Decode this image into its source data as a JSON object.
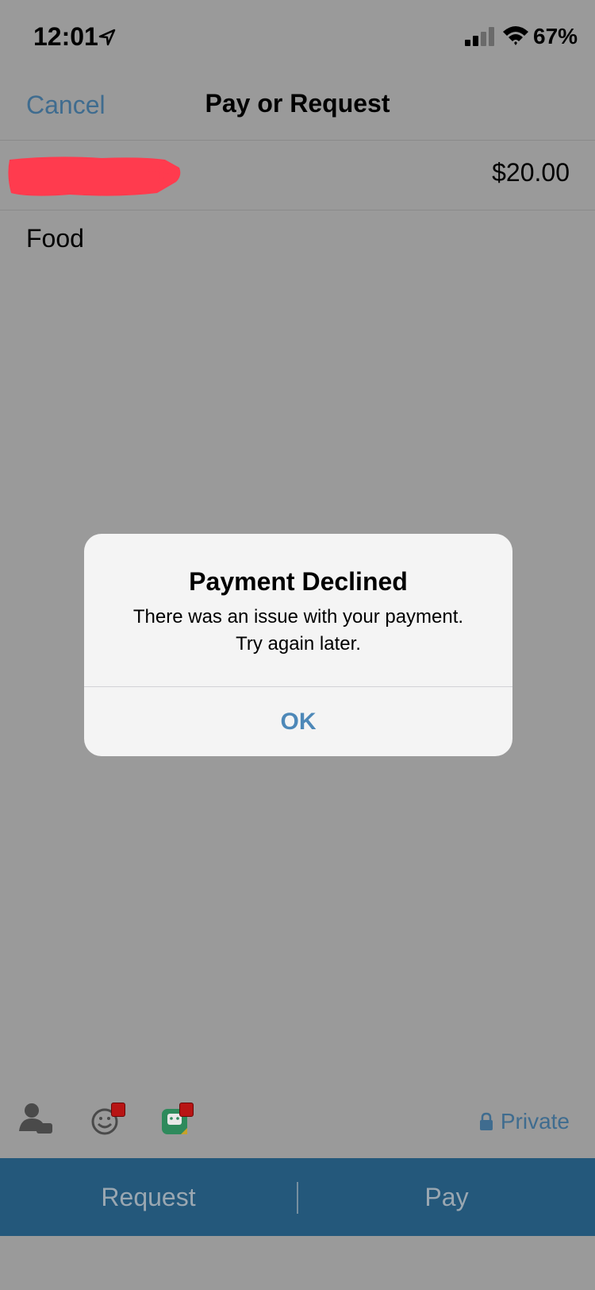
{
  "status_bar": {
    "time": "12:01",
    "battery": "67%"
  },
  "nav": {
    "cancel_label": "Cancel",
    "title": "Pay or Request"
  },
  "recipient": {
    "amount": "$20.00"
  },
  "note": "Food",
  "alert": {
    "title": "Payment Declined",
    "message_line1": "There was an issue with your payment.",
    "message_line2": "Try again later.",
    "ok_label": "OK"
  },
  "toolbar": {
    "private_label": "Private",
    "icons": [
      "contact-tag-icon",
      "emoji-icon",
      "sticker-icon",
      "lock-icon"
    ]
  },
  "actions": {
    "request_label": "Request",
    "pay_label": "Pay"
  },
  "colors": {
    "accent": "#3f6c8f",
    "action_bar": "#24587b",
    "alert_button": "#4d88b8",
    "redaction": "#ff3b4e",
    "badge": "#b81414"
  }
}
